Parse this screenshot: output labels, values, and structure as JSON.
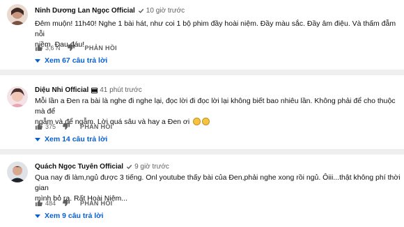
{
  "comments": [
    {
      "author": "Ninh Dương Lan Ngọc Official",
      "time": "10 giờ trước",
      "lines": [
        "Đêm muộn! 11h40! Nghe 1 bài hát, như coi 1 bộ phim đầy hoài niệm. Đầy màu sắc. Đầy âm điệu. Và thấm đẫm nỗi",
        "niềm. Đau đáu!"
      ],
      "likes": "3,6 N",
      "reply_label": "PHẢN HỒI",
      "view_replies": "Xem 67 câu trả lời"
    },
    {
      "author": "Diệu Nhi Official",
      "time": "41 phút trước",
      "lines": [
        "Mỗi lần a Đen ra bài là nghe đi nghe lại, đọc lời đi đọc lời lại không biết bao nhiêu lần. Không phải để cho thuộc mà để",
        "ngẫm và để ngẫm. Lời quá sâu và hay a Đen ơi"
      ],
      "likes": "375",
      "reply_label": "PHẢN HỒI",
      "view_replies": "Xem 14 câu trả lời"
    },
    {
      "author": "Quách Ngọc Tuyên Official",
      "time": "9 giờ trước",
      "lines": [
        "Qua nay đi làm,ngủ được 3 tiếng. Onl youtube thấy bài của Đen,phải nghe xong rồi ngủ. Ôiii...thật không phí thời gian",
        "mình bỏ ra. Rất Hoài Niệm..."
      ],
      "likes": "484",
      "reply_label": "PHẢN HỒI",
      "view_replies": "Xem 9 câu trả lời"
    }
  ],
  "colors": {
    "link": "#065fd4",
    "meta": "#606060",
    "separator": "#eeeeee"
  },
  "icons": [
    "verified-check-icon",
    "film-icon",
    "thumb-up-icon",
    "thumb-down-icon",
    "caret-down-icon",
    "smile-emoji-icon"
  ]
}
